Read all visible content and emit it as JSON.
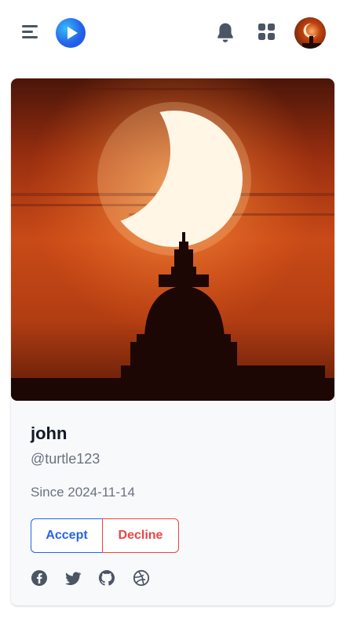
{
  "header": {
    "menu_icon": "menu-icon",
    "logo_icon": "play-logo-icon",
    "notification_icon": "bell-icon",
    "apps_icon": "grid-icon",
    "avatar_icon": "user-avatar"
  },
  "profile": {
    "name": "john",
    "handle": "@turtle123",
    "since": "Since 2024-11-14",
    "accept_label": "Accept",
    "decline_label": "Decline",
    "social_icons": [
      "facebook-icon",
      "twitter-icon",
      "github-icon",
      "dribbble-icon"
    ]
  },
  "colors": {
    "accent": "#2563eb",
    "danger": "#ef4444",
    "icon": "#4b5563",
    "muted_text": "#6b7280"
  }
}
